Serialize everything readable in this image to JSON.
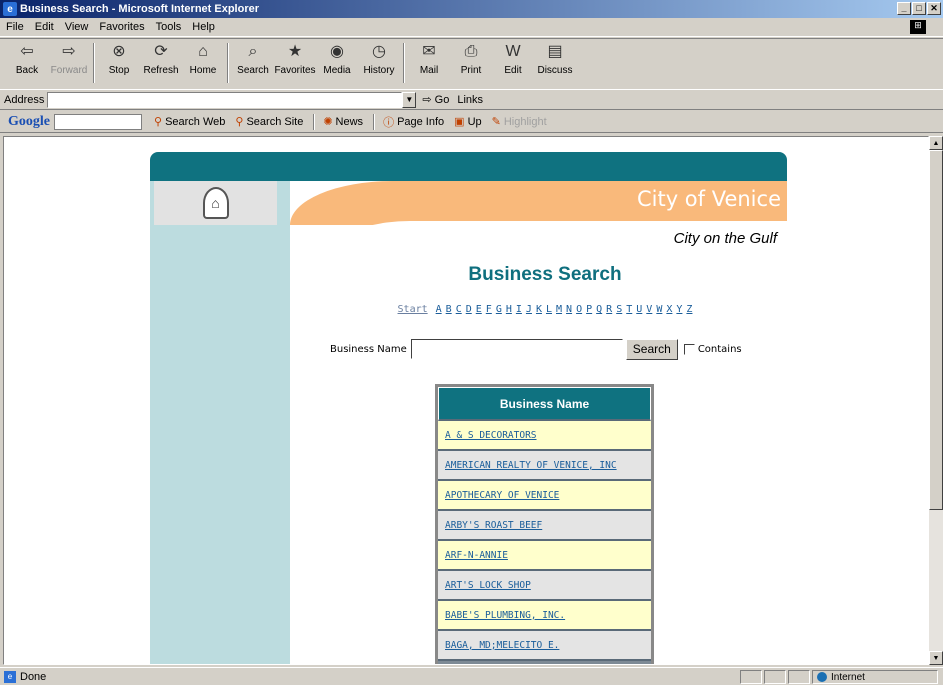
{
  "window": {
    "title": "Business Search - Microsoft Internet Explorer",
    "buttons": [
      "_",
      "□",
      "✕"
    ]
  },
  "menu": [
    "File",
    "Edit",
    "View",
    "Favorites",
    "Tools",
    "Help"
  ],
  "toolbar": [
    {
      "label": "Back",
      "icon": "back-icon",
      "glyph": "⇦",
      "enabled": true
    },
    {
      "label": "Forward",
      "icon": "forward-icon",
      "glyph": "⇨",
      "enabled": false
    },
    {
      "label": "Stop",
      "icon": "stop-icon",
      "glyph": "⊗",
      "enabled": true
    },
    {
      "label": "Refresh",
      "icon": "refresh-icon",
      "glyph": "⟳",
      "enabled": true
    },
    {
      "label": "Home",
      "icon": "home-icon",
      "glyph": "⌂",
      "enabled": true
    },
    {
      "label": "Search",
      "icon": "search-icon",
      "glyph": "⌕",
      "enabled": true
    },
    {
      "label": "Favorites",
      "icon": "favorites-icon",
      "glyph": "★",
      "enabled": true
    },
    {
      "label": "Media",
      "icon": "media-icon",
      "glyph": "◉",
      "enabled": true
    },
    {
      "label": "History",
      "icon": "history-icon",
      "glyph": "◷",
      "enabled": true
    },
    {
      "label": "Mail",
      "icon": "mail-icon",
      "glyph": "✉",
      "enabled": true
    },
    {
      "label": "Print",
      "icon": "print-icon",
      "glyph": "⎙",
      "enabled": true
    },
    {
      "label": "Edit",
      "icon": "edit-icon",
      "glyph": "W",
      "enabled": true
    },
    {
      "label": "Discuss",
      "icon": "discuss-icon",
      "glyph": "▤",
      "enabled": true
    }
  ],
  "address": {
    "label": "Address",
    "value": "",
    "go": "Go",
    "links": "Links"
  },
  "google": {
    "logo": "Google",
    "items": [
      {
        "label": "Search Web",
        "icon": "search-web-icon",
        "enabled": true
      },
      {
        "label": "Search Site",
        "icon": "search-site-icon",
        "enabled": true
      },
      {
        "label": "News",
        "icon": "news-icon",
        "enabled": true
      },
      {
        "label": "Page Info",
        "icon": "page-info-icon",
        "enabled": true
      },
      {
        "label": "Up",
        "icon": "up-folder-icon",
        "enabled": true
      },
      {
        "label": "Highlight",
        "icon": "highlight-icon",
        "enabled": false
      }
    ]
  },
  "page": {
    "city": "City of Venice",
    "tagline": "City on the Gulf",
    "heading": "Business Search",
    "alphabet": [
      "Start",
      "A",
      "B",
      "C",
      "D",
      "E",
      "F",
      "G",
      "H",
      "I",
      "J",
      "K",
      "L",
      "M",
      "N",
      "O",
      "P",
      "Q",
      "R",
      "S",
      "T",
      "U",
      "V",
      "W",
      "X",
      "Y",
      "Z"
    ],
    "search": {
      "label": "Business Name",
      "value": "",
      "button": "Search",
      "contains": "Contains"
    },
    "table": {
      "header": "Business Name",
      "rows": [
        "A & S DECORATORS",
        "AMERICAN REALTY OF VENICE, INC",
        "APOTHECARY OF VENICE",
        "ARBY'S ROAST BEEF",
        "ARF-N-ANNIE",
        "ART'S LOCK SHOP",
        "BABE'S PLUMBING, INC.",
        "BAGA, MD;MELECITO E."
      ]
    }
  },
  "status": {
    "text": "Done",
    "zone": "Internet"
  }
}
